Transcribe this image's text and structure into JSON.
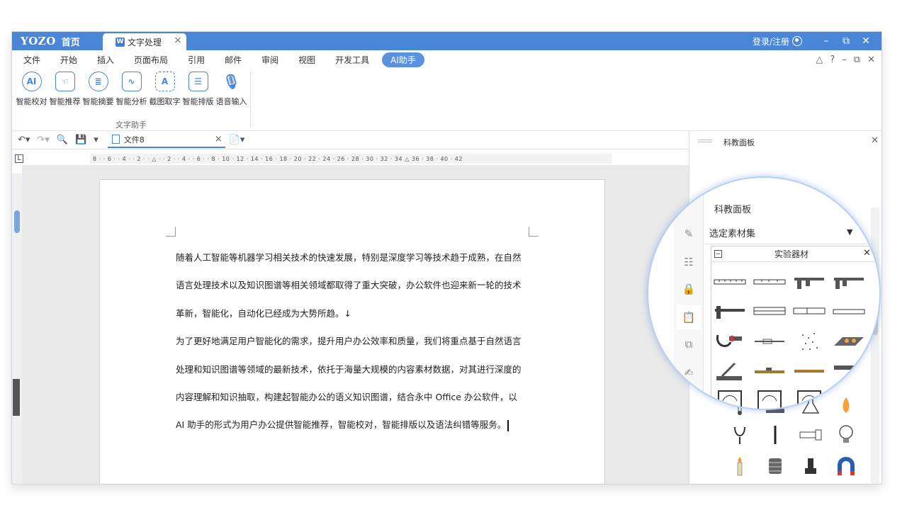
{
  "titlebar": {
    "brand": "YOZO",
    "home": "首页",
    "doc_tab": "文字处理",
    "login": "登录/注册"
  },
  "menu": {
    "items": [
      "文件",
      "开始",
      "插入",
      "页面布局",
      "引用",
      "邮件",
      "审阅",
      "视图",
      "开发工具",
      "AI助手"
    ],
    "active": "AI助手"
  },
  "ribbon": {
    "tools": [
      "智能校对",
      "智能推荐",
      "智能摘要",
      "智能分析",
      "截图取字",
      "智能排版",
      "语音输入"
    ],
    "group_label": "文字助手"
  },
  "document": {
    "tab_name": "文件8",
    "paragraphs": [
      "随着人工智能等机器学习相关技术的快速发展，特别是深度学习等技术趋于成熟，在自然",
      "语言处理技术以及知识图谱等相关领域都取得了重大突破，办公软件也迎来新一轮的技术",
      "革新，智能化，自动化已经成为大势所趋。↓",
      "为了更好地满足用户智能化的需求，提升用户办公效率和质量，我们将重点基于自然语言",
      "处理和知识图谱等领域的最新技术，依托于海量大规模的内容素材数据，对其进行深度的",
      "内容理解和知识抽取，构建起智能办公的语义知识图谱，结合永中 Office 办公软件，以",
      "AI 助手的形式为用户办公提供智能推荐，智能校对，智能排版以及语法纠错等服务。"
    ]
  },
  "ruler": {
    "labels": "8 · · 6 · · 4 · · 2 · · △ · · 2 · · 4 · · 6 · · 8 · 10 · 12 · 14 · 16 · 18 · 20 · 22 · 24 · 26 · 28 · 30 · 32 · 34 △ 36 · 38 · 40 · 42"
  },
  "panel": {
    "title": "科教面板",
    "zoom_title": "科教面板",
    "selector": "选定素材集",
    "group": "实验器材"
  },
  "colors": {
    "accent": "#4a86d8",
    "panel_border": "#b9cff0"
  }
}
